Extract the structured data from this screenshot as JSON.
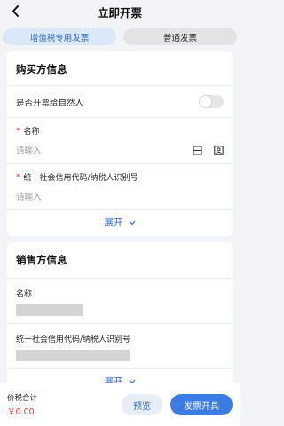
{
  "header": {
    "back_icon": "chevron-left-icon",
    "title": "立即开票"
  },
  "tabs": [
    {
      "label": "增值税专用发票",
      "active": true
    },
    {
      "label": "普通发票",
      "active": false
    }
  ],
  "buyer": {
    "title": "购买方信息",
    "natural_person_label": "是否开票给自然人",
    "natural_person_on": false,
    "name_label": "名称",
    "name_required_mark": "*",
    "name_placeholder": "请输入",
    "tax_id_label": "统一社会信用代码/纳税人识别号",
    "tax_id_required_mark": "*",
    "tax_id_placeholder": "请输入",
    "expand_label": "展开"
  },
  "seller": {
    "title": "销售方信息",
    "name_label": "名称",
    "tax_id_label": "统一社会信用代码/纳税人识别号",
    "expand_label": "展开"
  },
  "footer": {
    "total_label": "价税合计",
    "total_value": "￥0.00",
    "preview_label": "预览",
    "issue_label": "发票开具"
  },
  "colors": {
    "accent": "#3b7be4",
    "required": "#e23b3b"
  }
}
